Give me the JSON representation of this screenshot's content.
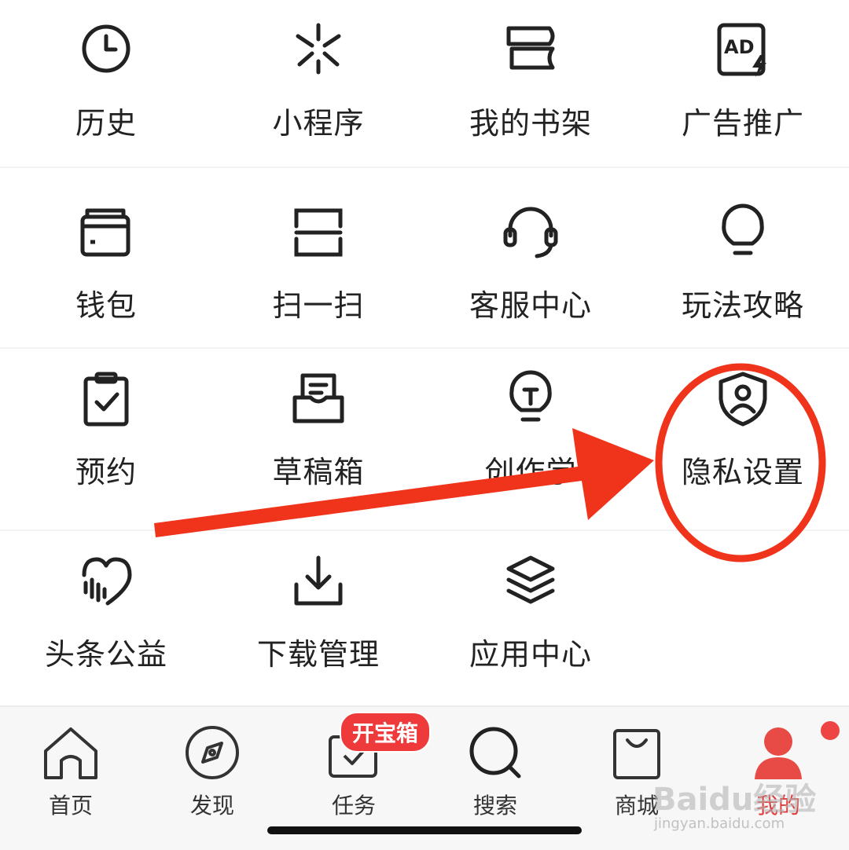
{
  "menu": {
    "row1": [
      {
        "label": "历史",
        "icon": "clock-icon"
      },
      {
        "label": "小程序",
        "icon": "mini-program-icon"
      },
      {
        "label": "我的书架",
        "icon": "bookshelf-icon"
      },
      {
        "label": "广告推广",
        "icon": "ad-promo-icon"
      }
    ],
    "row2": [
      {
        "label": "钱包",
        "icon": "wallet-icon"
      },
      {
        "label": "扫一扫",
        "icon": "scan-icon"
      },
      {
        "label": "客服中心",
        "icon": "headset-icon"
      },
      {
        "label": "玩法攻略",
        "icon": "lightbulb-icon"
      }
    ],
    "row3": [
      {
        "label": "预约",
        "icon": "clipboard-check-icon"
      },
      {
        "label": "草稿箱",
        "icon": "drafts-inbox-icon"
      },
      {
        "label": "创作学",
        "icon": "bulb-t-icon"
      },
      {
        "label": "隐私设置",
        "icon": "shield-user-icon"
      }
    ],
    "row4": [
      {
        "label": "头条公益",
        "icon": "charity-heart-icon"
      },
      {
        "label": "下载管理",
        "icon": "download-icon"
      },
      {
        "label": "应用中心",
        "icon": "layers-icon"
      }
    ]
  },
  "tabbar": {
    "items": [
      {
        "label": "首页",
        "icon": "home-icon"
      },
      {
        "label": "发现",
        "icon": "compass-icon"
      },
      {
        "label": "任务",
        "icon": "task-icon",
        "badge": "开宝箱"
      },
      {
        "label": "搜索",
        "icon": "search-icon"
      },
      {
        "label": "商城",
        "icon": "shopping-bag-icon"
      },
      {
        "label": "我的",
        "icon": "user-icon",
        "active": true
      }
    ]
  },
  "watermark": {
    "text": "Baidu经验",
    "sub": "jingyan.baidu.com"
  },
  "colors": {
    "accent": "#e23b3b",
    "annotation": "#f0341c",
    "icon": "#222222"
  }
}
